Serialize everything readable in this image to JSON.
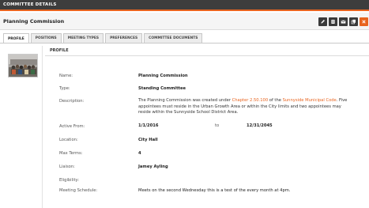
{
  "header": {
    "title": "COMMITTEE DETAILS"
  },
  "committee_name": "Planning Commission",
  "toolbar": {
    "icons": [
      "pencil-icon",
      "document-icon",
      "mail-icon",
      "copy-icon",
      "close-icon"
    ]
  },
  "tabs": [
    {
      "label": "PROFILE",
      "active": true
    },
    {
      "label": "POSITIONS"
    },
    {
      "label": "MEETING TYPES"
    },
    {
      "label": "PREFERENCES"
    },
    {
      "label": "COMMITTEE DOCUMENTS"
    }
  ],
  "profile": {
    "heading": "PROFILE",
    "name_label": "Name:",
    "name_value": "Planning Commission",
    "type_label": "Type:",
    "type_value": "Standing Committee",
    "description_label": "Description:",
    "description_text_1": "The Planning Commission was created under ",
    "description_link_1": "Chapter 2.50.100",
    "description_text_2": " of the ",
    "description_link_2": "Sunnyside Municipal Code",
    "description_text_3": ". Five appointees must reside in the Urban Growth Area or within the City limits and two appointees may reside within the Sunnyside School District Area.",
    "active_from_label": "Active From:",
    "active_from_value": "1/1/2016",
    "active_to_label": "to",
    "active_to_value": "12/31/2045",
    "location_label": "Location:",
    "location_value": "City Hall",
    "max_terms_label": "Max Terms:",
    "max_terms_value": "4",
    "liaison_label": "Liaison:",
    "liaison_value": "Jamey Ayling",
    "eligibility_label": "Eligibility:",
    "meeting_schedule_label": "Meeting Schedule:",
    "meeting_schedule_value": "Meets on the second Wednesday this is a test of the every month at 4pm."
  },
  "colors": {
    "accent": "#e8641f",
    "dark": "#3d3d3d"
  }
}
